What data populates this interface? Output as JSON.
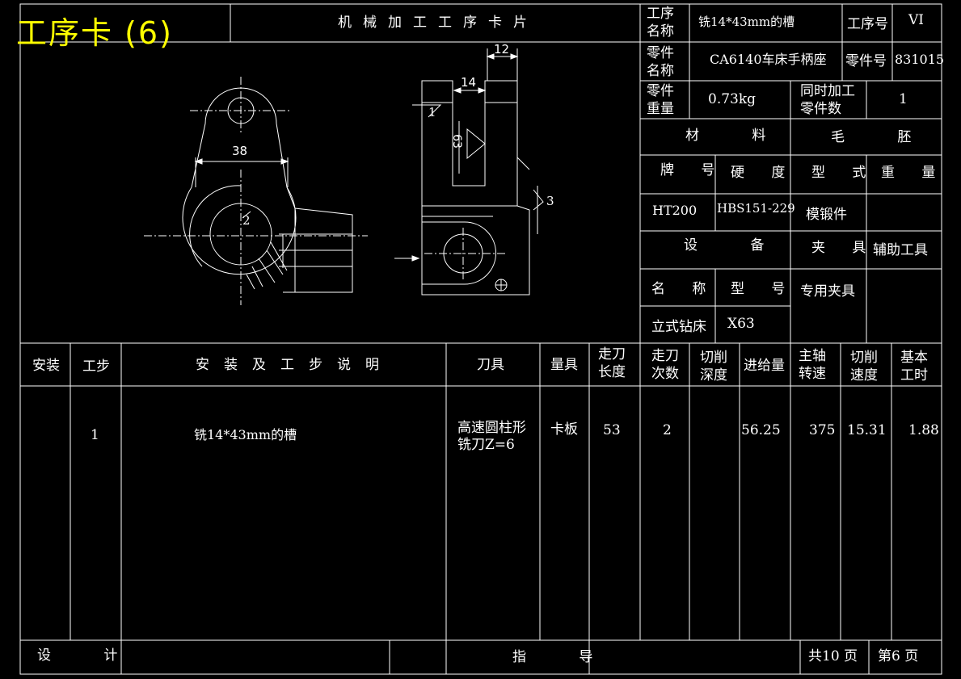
{
  "title": "工序卡 (6)",
  "card_name": "机械加工工序卡片",
  "header": {
    "process_name_label": "工序\n名称",
    "process_name_value": "铣14*43mm的槽",
    "process_no_label": "工序号",
    "process_no_value": "VI",
    "part_name_label": "零件\n名称",
    "part_name_value": "CA6140车床手柄座",
    "part_no_label": "零件号",
    "part_no_value": "831015",
    "part_weight_label": "零件\n重量",
    "part_weight_value": "0.73kg",
    "simultaneous_label": "同时加工\n零件数",
    "simultaneous_value": "1",
    "material_label": "材 料",
    "blank_label": "毛 胚",
    "grade_label": "牌 号",
    "hardness_label": "硬 度",
    "type_label": "型 式",
    "weight_label": "重 量",
    "grade_value": "HT200",
    "hardness_value": "HBS151-229",
    "type_value": "模锻件",
    "equipment_label": "设 备",
    "fixture_label": "夹 具",
    "aux_tool_label": "辅助工具",
    "eq_name_label": "名 称",
    "eq_model_label": "型 号",
    "fixture_value": "专用夹具",
    "eq_name_value": "立式钻床",
    "eq_model_value": "X63"
  },
  "drawing": {
    "dim_38": "38",
    "dim_12": "12",
    "dim_14": "14",
    "dim_63": "63",
    "label_1": "1",
    "label_2": "2",
    "label_3": "3"
  },
  "table": {
    "columns": [
      "安装",
      "工步",
      "安装及工步说明",
      "刀具",
      "量具",
      "走刀\n长度",
      "走刀\n次数",
      "切削\n深度",
      "进给量",
      "主轴\n转速",
      "切削\n速度",
      "基本\n工时"
    ],
    "rows": [
      {
        "install": "",
        "step": "1",
        "desc": "铣14*43mm的槽",
        "tool": "高速圆柱形\n铣刀Z=6",
        "gauge": "卡板",
        "length": "53",
        "passes": "2",
        "depth": "",
        "feed": "56.25",
        "speed": "375",
        "cut_speed": "15.31",
        "time": "1.88"
      }
    ]
  },
  "footer": {
    "design_label": "设 计",
    "guide_label": "指 导",
    "total_pages": "共10 页",
    "page_no": "第6 页"
  }
}
